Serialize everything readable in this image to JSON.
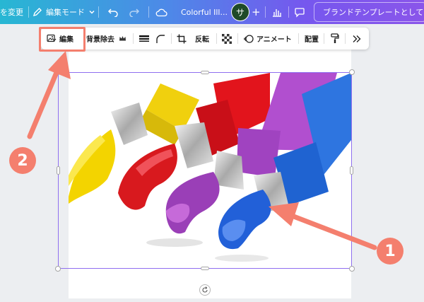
{
  "topbar": {
    "change_label": "を変更",
    "edit_mode_label": "編集モード",
    "doc_title": "Colorful Ill...",
    "avatar_letter": "サ",
    "publish_label": "ブランドテンプレートとして公開"
  },
  "toolbar": {
    "edit_label": "編集",
    "bg_remove_label": "背景除去",
    "flip_label": "反転",
    "animate_label": "アニメート",
    "position_label": "配置"
  },
  "annotations": {
    "badge_1": "1",
    "badge_2": "2",
    "color": "#f47f6e"
  },
  "photo": {
    "description_icon": "paint-tubes-image",
    "colors": [
      "#f3d400",
      "#d8191e",
      "#9a3fb7",
      "#2260d8"
    ]
  }
}
